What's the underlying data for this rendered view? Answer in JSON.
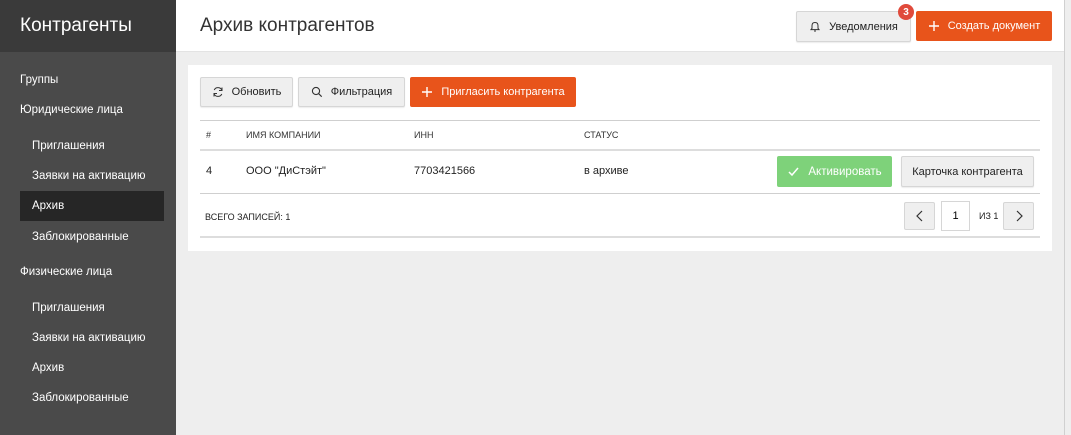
{
  "sidebar": {
    "title": "Контрагенты",
    "groups": "Группы",
    "legal": {
      "label": "Юридические лица",
      "items": [
        "Приглашения",
        "Заявки на активацию",
        "Архив",
        "Заблокированные"
      ]
    },
    "individuals": {
      "label": "Физические лица",
      "items": [
        "Приглашения",
        "Заявки на активацию",
        "Архив",
        "Заблокированные"
      ]
    },
    "active_item": "Архив"
  },
  "header": {
    "title": "Архив контрагентов",
    "notifications_label": "Уведомления",
    "notifications_count": "3",
    "create_label": "Создать документ"
  },
  "toolbar": {
    "refresh_label": "Обновить",
    "filter_label": "Фильтрация",
    "invite_label": "Пригласить контрагента"
  },
  "table": {
    "columns": [
      "#",
      "ИМЯ КОМПАНИИ",
      "ИНН",
      "СТАТУС"
    ],
    "rows": [
      {
        "num": "4",
        "company": "ООО \"ДиСтэйт\"",
        "inn": "7703421566",
        "status": "в архиве",
        "activate_label": "Активировать",
        "card_label": "Карточка контрагента"
      }
    ],
    "total_label": "ВСЕГО ЗАПИСЕЙ: 1"
  },
  "pagination": {
    "page": "1",
    "of_label": "ИЗ 1"
  },
  "colors": {
    "accent": "#e8541b",
    "success": "#7ed27a",
    "sidebar_bg": "#4a4a4a",
    "sidebar_active": "#262626",
    "badge": "#e04a3b"
  }
}
